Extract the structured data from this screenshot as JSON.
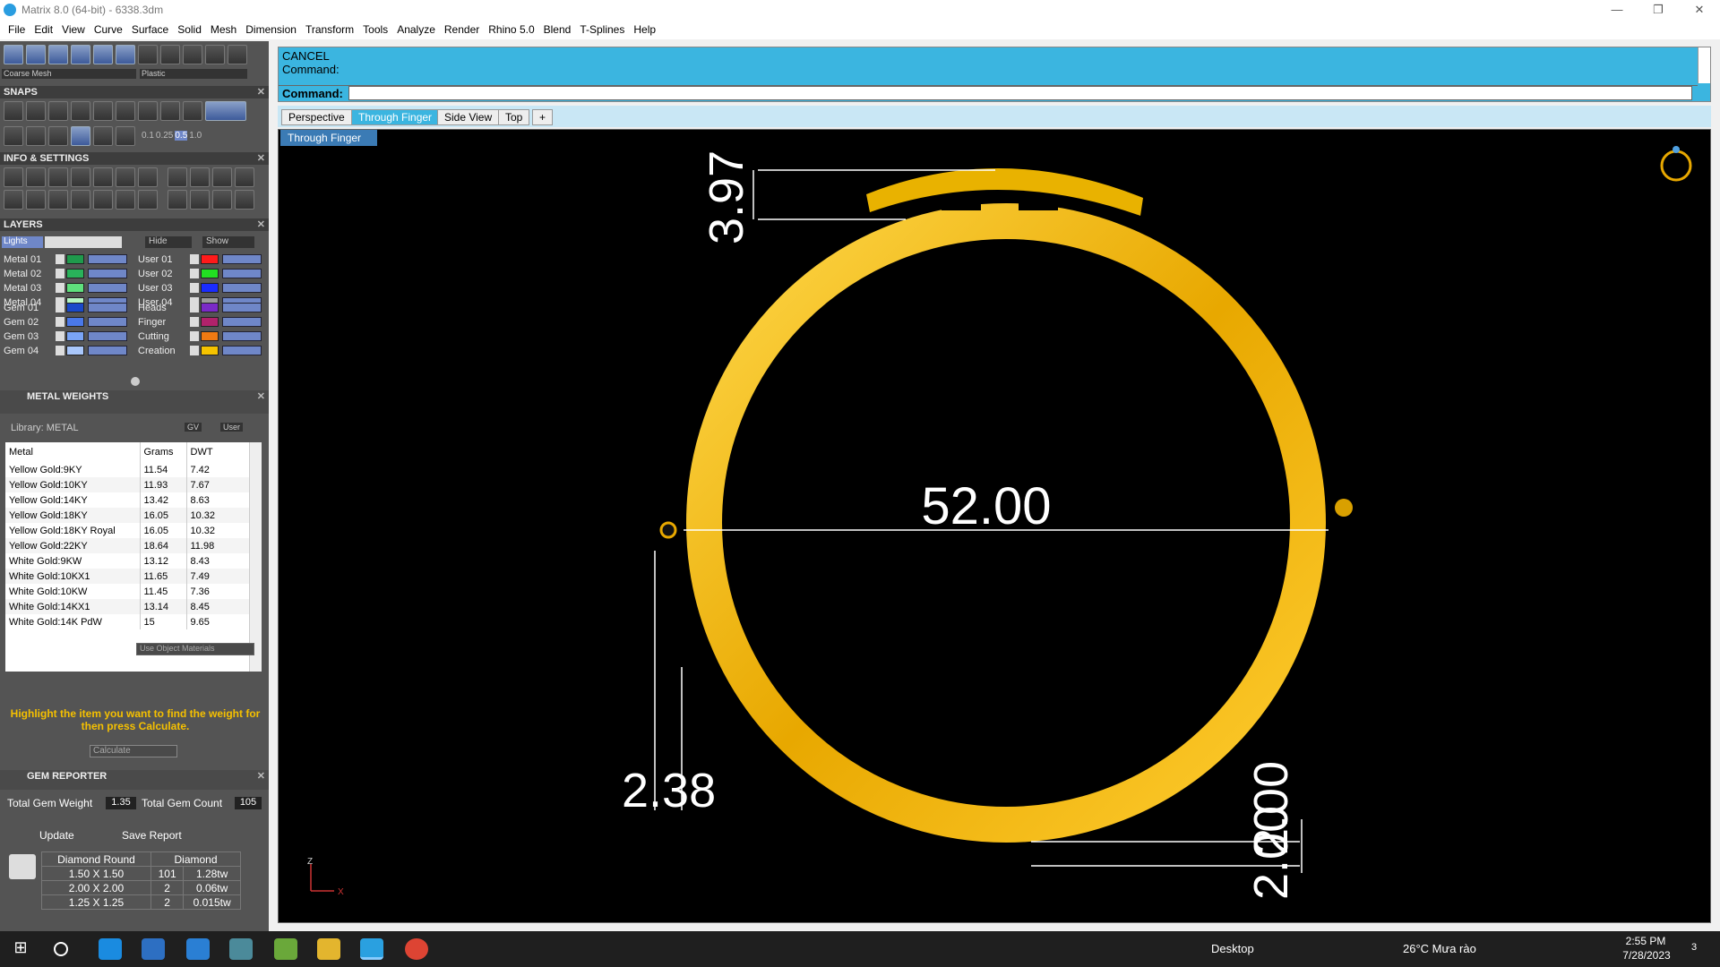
{
  "window": {
    "title": "Matrix 8.0 (64-bit) - 6338.3dm",
    "buttons": [
      "—",
      "❐",
      "✕"
    ]
  },
  "menu": [
    "File",
    "Edit",
    "View",
    "Curve",
    "Surface",
    "Solid",
    "Mesh",
    "Dimension",
    "Transform",
    "Tools",
    "Analyze",
    "Render",
    "Rhino 5.0",
    "Blend",
    "T-Splines",
    "Help"
  ],
  "toolbar": {
    "mesh_select": "Coarse Mesh",
    "material_select": "Plastic"
  },
  "panels": {
    "snaps": "SNAPS",
    "snap_values": [
      "0.1",
      "0.25",
      "0.5",
      "1.0"
    ],
    "info": "INFO & SETTINGS",
    "layers": "LAYERS",
    "metal_weights": "METAL WEIGHTS",
    "gem_reporter": "GEM REPORTER"
  },
  "layers": {
    "lights": "Lights",
    "hide": "Hide",
    "show": "Show",
    "left": [
      {
        "name": "Metal 01",
        "color": "#1f9a4c"
      },
      {
        "name": "Metal 02",
        "color": "#29b25a"
      },
      {
        "name": "Metal 03",
        "color": "#5fe07d"
      },
      {
        "name": "Metal 04",
        "color": "#b5f5c3"
      },
      {
        "name": "Gem 01",
        "color": "#1a49c9"
      },
      {
        "name": "Gem 02",
        "color": "#4a78e8"
      },
      {
        "name": "Gem 03",
        "color": "#7aa4f5"
      },
      {
        "name": "Gem 04",
        "color": "#a9c7fb"
      }
    ],
    "right": [
      {
        "name": "User 01",
        "color": "#ff1a1a"
      },
      {
        "name": "User 02",
        "color": "#22e022"
      },
      {
        "name": "User 03",
        "color": "#1a2cff"
      },
      {
        "name": "User 04",
        "color": "#9a9a9a"
      },
      {
        "name": "Heads",
        "color": "#7a2ac7"
      },
      {
        "name": "Finger",
        "color": "#b1226b"
      },
      {
        "name": "Cutting",
        "color": "#f07a12"
      },
      {
        "name": "Creation",
        "color": "#f5c300"
      }
    ]
  },
  "metal": {
    "library": "Library: METAL",
    "gv": "GV",
    "user": "User",
    "headers": [
      "Metal",
      "Grams",
      "DWT"
    ],
    "rows": [
      [
        "Yellow Gold:9KY",
        "11.54",
        "7.42"
      ],
      [
        "Yellow Gold:10KY",
        "11.93",
        "7.67"
      ],
      [
        "Yellow Gold:14KY",
        "13.42",
        "8.63"
      ],
      [
        "Yellow Gold:18KY",
        "16.05",
        "10.32"
      ],
      [
        "Yellow Gold:18KY Royal",
        "16.05",
        "10.32"
      ],
      [
        "Yellow Gold:22KY",
        "18.64",
        "11.98"
      ],
      [
        "White Gold:9KW",
        "13.12",
        "8.43"
      ],
      [
        "White Gold:10KX1",
        "11.65",
        "7.49"
      ],
      [
        "White Gold:10KW",
        "11.45",
        "7.36"
      ],
      [
        "White Gold:14KX1",
        "13.14",
        "8.45"
      ],
      [
        "White Gold:14K PdW",
        "15",
        "9.65"
      ]
    ],
    "use_object_materials": "Use Object Materials",
    "hint": "Highlight the item you want to find the weight for then press Calculate.",
    "calculate": "Calculate"
  },
  "gem": {
    "total_weight_label": "Total Gem Weight",
    "total_weight": "1.35",
    "total_count_label": "Total Gem Count",
    "total_count": "105",
    "update": "Update",
    "save_report": "Save Report",
    "headers": [
      "Diamond Round",
      "Diamond"
    ],
    "rows": [
      [
        "1.50 X 1.50",
        "101",
        "1.28tw"
      ],
      [
        "2.00 X 2.00",
        "2",
        "0.06tw"
      ],
      [
        "1.25 X 1.25",
        "2",
        "0.015tw"
      ]
    ]
  },
  "command": {
    "line1": "CANCEL",
    "line2": "Command:",
    "prompt": "Command:"
  },
  "tabs": [
    "Perspective",
    "Through Finger",
    "Side View",
    "Top",
    "+"
  ],
  "active_tab": "Through Finger",
  "view_select": "Through Finger",
  "dims": {
    "top": "3.97",
    "diameter": "52.00",
    "left_bottom": "2.38",
    "right_bottom_1": "2.00",
    "right_bottom_2": "2.00"
  },
  "axis": {
    "z": "Z",
    "x": "X"
  },
  "taskbar": {
    "desktop": "Desktop",
    "weather": "26°C  Mưa rào",
    "time": "2:55 PM",
    "date": "7/28/2023",
    "notif": "3"
  }
}
